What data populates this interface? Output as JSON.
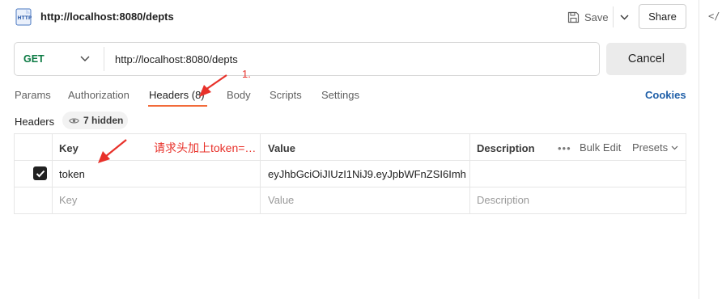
{
  "header": {
    "icon": "http-file-icon",
    "title": "http://localhost:8080/depts",
    "save_label": "Save",
    "share_label": "Share",
    "side_icon": "</"
  },
  "request": {
    "method": "GET",
    "url": "http://localhost:8080/depts",
    "send_label": "Cancel"
  },
  "tabs": [
    {
      "label": "Params",
      "active": false
    },
    {
      "label": "Authorization",
      "active": false
    },
    {
      "label": "Headers (8)",
      "active": true
    },
    {
      "label": "Body",
      "active": false
    },
    {
      "label": "Scripts",
      "active": false
    },
    {
      "label": "Settings",
      "active": false
    }
  ],
  "cookies_label": "Cookies",
  "headers_section": {
    "label": "Headers",
    "hidden_label": "7 hidden"
  },
  "table": {
    "columns": [
      "Key",
      "Value",
      "Description"
    ],
    "toolbar": {
      "more": "•••",
      "bulk_edit": "Bulk Edit",
      "presets": "Presets"
    },
    "rows": [
      {
        "checked": true,
        "key": "token",
        "value": "eyJhbGciOiJIUzI1NiJ9.eyJpbWFnZSI6Imh…",
        "description": ""
      }
    ],
    "placeholder": {
      "key": "Key",
      "value": "Value",
      "description": "Description"
    }
  },
  "annotations": {
    "step": "1.",
    "note": "请求头加上token=…"
  },
  "colors": {
    "method": "#0b7a43",
    "tab_active_underline": "#f26b3a",
    "cookies_link": "#1f5fa8",
    "annotation": "#e8312a"
  }
}
